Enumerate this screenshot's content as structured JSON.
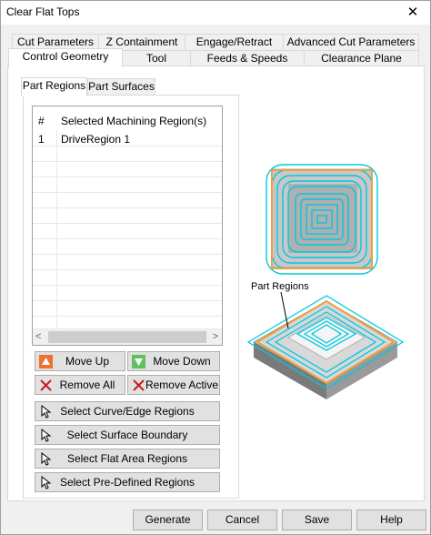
{
  "window": {
    "title": "Clear Flat Tops",
    "close_glyph": "✕"
  },
  "tabs_row1": [
    {
      "label": "Cut Parameters"
    },
    {
      "label": "Z Containment"
    },
    {
      "label": "Engage/Retract"
    },
    {
      "label": "Advanced Cut Parameters"
    }
  ],
  "tabs_row2": [
    {
      "label": "Control Geometry",
      "active": true
    },
    {
      "label": "Tool"
    },
    {
      "label": "Feeds & Speeds"
    },
    {
      "label": "Clearance Plane"
    }
  ],
  "subtabs": [
    {
      "label": "Part Regions",
      "active": true
    },
    {
      "label": "Part Surfaces"
    }
  ],
  "list": {
    "col_num": "#",
    "col_name": "Selected Machining Region(s)",
    "rows": [
      {
        "num": "1",
        "name": "DriveRegion 1"
      }
    ],
    "scroll_left": "<",
    "scroll_right": ">"
  },
  "buttons": {
    "move_up": "Move Up",
    "move_down": "Move Down",
    "remove_all": "Remove All",
    "remove_active": "Remove Active",
    "select_curve": "Select Curve/Edge Regions",
    "select_surface": "Select Surface Boundary",
    "select_flat": "Select Flat Area Regions",
    "select_predefined": "Select Pre-Defined Regions"
  },
  "preview": {
    "label": "Part Regions",
    "toolpath_color": "#00c8e0",
    "boundary_color": "#e8a040"
  },
  "footer": {
    "generate": "Generate",
    "cancel": "Cancel",
    "save": "Save",
    "help": "Help"
  },
  "colors": {
    "move_up_icon": "#f07030",
    "move_down_icon": "#60c060",
    "remove_icon": "#c02020"
  }
}
